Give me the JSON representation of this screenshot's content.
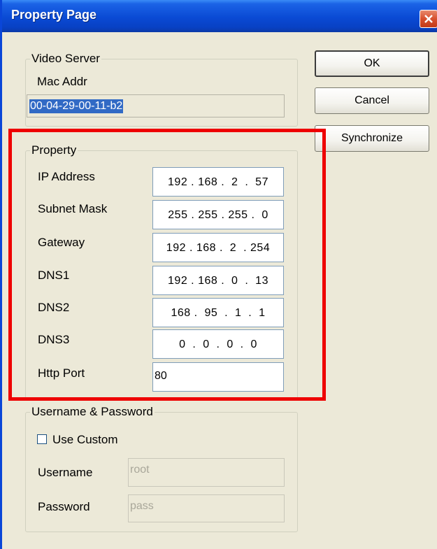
{
  "window": {
    "title": "Property Page"
  },
  "video_server": {
    "group_label": "Video Server",
    "mac_label": "Mac Addr",
    "mac_value": "00-04-29-00-11-b2"
  },
  "property": {
    "group_label": "Property",
    "fields": [
      {
        "label": "IP Address",
        "value": "192 . 168 .  2  .  57"
      },
      {
        "label": "Subnet Mask",
        "value": "255 . 255 . 255 .  0"
      },
      {
        "label": "Gateway",
        "value": "192 . 168 .  2  . 254"
      },
      {
        "label": "DNS1",
        "value": "192 . 168 .  0  .  13"
      },
      {
        "label": "DNS2",
        "value": "168 .  95  .  1  .  1"
      },
      {
        "label": "DNS3",
        "value": "0  .  0  .  0  .  0"
      }
    ],
    "http_port_label": "Http Port",
    "http_port_value": "80"
  },
  "credentials": {
    "group_label": "Username & Password",
    "use_custom_label": "Use Custom",
    "use_custom_checked": false,
    "username_label": "Username",
    "username_value": "root",
    "password_label": "Password",
    "password_value": "pass"
  },
  "buttons": {
    "ok": "OK",
    "cancel": "Cancel",
    "synchronize": "Synchronize"
  },
  "colors": {
    "highlight": "#ee0000",
    "titlebar": "#0a4ad4",
    "selection": "#316ac5"
  }
}
